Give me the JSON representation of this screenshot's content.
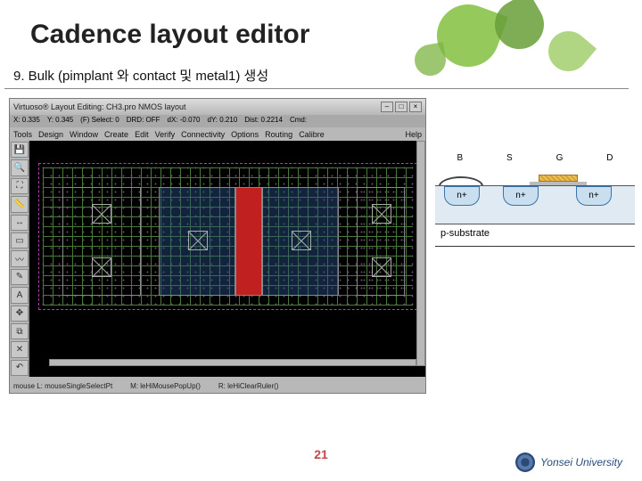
{
  "slide": {
    "title": "Cadence layout editor",
    "step": "9. Bulk (pimplant 와 contact 및 metal1) 생성",
    "page": "21",
    "university": "Yonsei University"
  },
  "editor": {
    "window_title": "Virtuoso® Layout Editing: CH3.pro NMOS layout",
    "status": {
      "x": "X: 0.335",
      "y": "Y: 0.345",
      "sel": "(F) Select: 0",
      "drd": "DRD: OFF",
      "dx": "dX: -0.070",
      "dy": "dY: 0.210",
      "dist": "Dist: 0.2214",
      "cmd": "Cmd:"
    },
    "menus": [
      "Tools",
      "Design",
      "Window",
      "Create",
      "Edit",
      "Verify",
      "Connectivity",
      "Options",
      "Routing",
      "Calibre",
      "Help"
    ],
    "prompt": {
      "l": "mouse L: mouseSingleSelectPt",
      "m": "M: leHiMousePopUp()",
      "r": "R: leHiClearRuler()"
    },
    "layers": [
      "pimplant",
      "contact",
      "metal1",
      "poly",
      "nactive"
    ]
  },
  "xsection": {
    "terminals": [
      "B",
      "S",
      "G",
      "D"
    ],
    "nplus": "n+",
    "substrate": "p-substrate"
  },
  "colors": {
    "poly_gate": "#c02020",
    "metal1": "#2a5a9a",
    "green_leaf": "#8bc34a",
    "purple_dash": "#b040b0"
  }
}
